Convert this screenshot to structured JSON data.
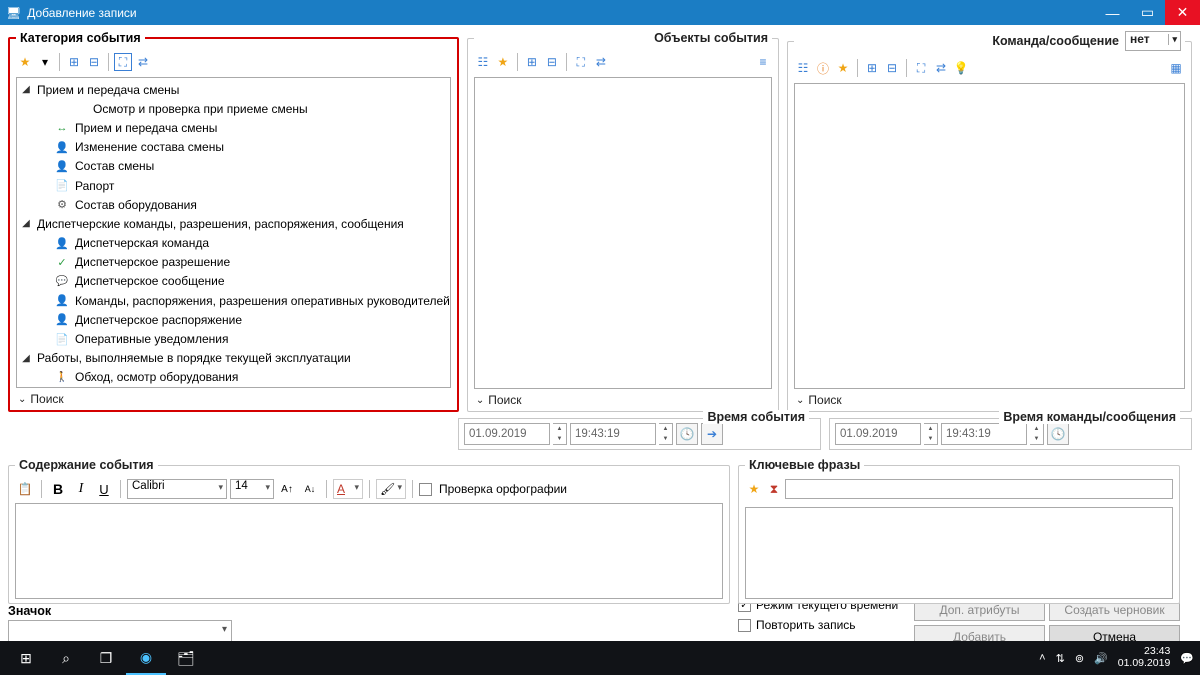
{
  "window": {
    "title": "Добавление записи"
  },
  "category": {
    "title": "Категория события",
    "search": "Поиск",
    "tree": [
      {
        "depth": 1,
        "expander": "◢",
        "icon": "",
        "label": "Прием и передача смены"
      },
      {
        "depth": 3,
        "expander": "",
        "icon": "",
        "label": "Осмотр и проверка при приеме смены"
      },
      {
        "depth": 2,
        "expander": "",
        "icon": "arrow-icon i-green",
        "label": "Прием и передача смены"
      },
      {
        "depth": 2,
        "expander": "",
        "icon": "person-icon i-blue",
        "label": "Изменение состава смены"
      },
      {
        "depth": 2,
        "expander": "",
        "icon": "person-icon i-blue",
        "label": "Состав смены"
      },
      {
        "depth": 2,
        "expander": "",
        "icon": "doc-icon",
        "label": "Рапорт"
      },
      {
        "depth": 2,
        "expander": "",
        "icon": "gear-icon i-gray",
        "label": "Состав оборудования"
      },
      {
        "depth": 1,
        "expander": "◢",
        "icon": "",
        "label": "Диспетчерские команды, разрешения, распоряжения, сообщения"
      },
      {
        "depth": 2,
        "expander": "",
        "icon": "person-icon i-blue",
        "label": "Диспетчерская команда"
      },
      {
        "depth": 2,
        "expander": "",
        "icon": "check-icon i-green",
        "label": "Диспетчерское разрешение"
      },
      {
        "depth": 2,
        "expander": "",
        "icon": "speak-icon",
        "label": "Диспетчерское сообщение"
      },
      {
        "depth": 2,
        "expander": "",
        "icon": "person-icon i-blue",
        "label": "Команды, распоряжения, разрешения оперативных руководителей"
      },
      {
        "depth": 2,
        "expander": "",
        "icon": "person-icon i-orange",
        "label": "Диспетчерское распоряжение"
      },
      {
        "depth": 2,
        "expander": "",
        "icon": "doc-icon",
        "label": "Оперативные уведомления"
      },
      {
        "depth": 1,
        "expander": "◢",
        "icon": "",
        "label": "Работы, выполняемые в порядке текущей эксплуатации"
      },
      {
        "depth": 2,
        "expander": "",
        "icon": "walk-icon",
        "label": "Обход, осмотр оборудования"
      }
    ]
  },
  "objects": {
    "title": "Объекты события",
    "search": "Поиск"
  },
  "command": {
    "title": "Команда/сообщение",
    "select_value": "нет",
    "search": "Поиск"
  },
  "event_time": {
    "title": "Время события",
    "date": "01.09.2019",
    "time": "19:43:19"
  },
  "command_time": {
    "title": "Время команды/сообщения",
    "date": "01.09.2019",
    "time": "19:43:19"
  },
  "content": {
    "title": "Содержание события",
    "font": "Calibri",
    "size": "14",
    "spellcheck": "Проверка орфографии"
  },
  "keyphrases": {
    "title": "Ключевые фразы"
  },
  "icon_section": {
    "label": "Значок"
  },
  "options": {
    "current_time": "Режим текущего времени",
    "repeat": "Повторить запись"
  },
  "buttons": {
    "extra": "Доп. атрибуты",
    "draft": "Создать черновик",
    "add": "Добавить",
    "cancel": "Отмена"
  },
  "taskbar": {
    "time": "23:43",
    "date": "01.09.2019"
  }
}
